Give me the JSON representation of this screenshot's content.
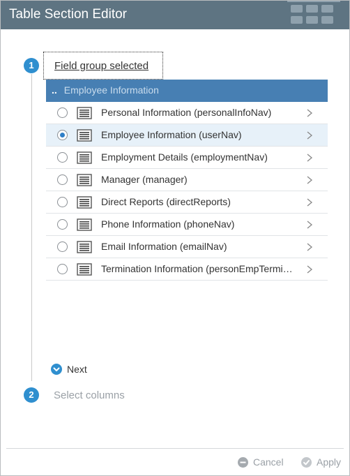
{
  "dialog": {
    "title": "Table Section Editor",
    "header_icon": "table-grid-icon"
  },
  "steps": [
    {
      "number": "1",
      "label": "Field group selected"
    },
    {
      "number": "2",
      "label": "Select columns"
    }
  ],
  "breadcrumb": {
    "up": "..",
    "current": "Employee Information"
  },
  "field_groups": [
    {
      "label": "Personal Information (personalInfoNav)",
      "selected": false
    },
    {
      "label": "Employee Information (userNav)",
      "selected": true
    },
    {
      "label": "Employment Details (employmentNav)",
      "selected": false
    },
    {
      "label": "Manager (manager)",
      "selected": false
    },
    {
      "label": "Direct Reports (directReports)",
      "selected": false
    },
    {
      "label": "Phone Information (phoneNav)",
      "selected": false
    },
    {
      "label": "Email Information (emailNav)",
      "selected": false
    },
    {
      "label": "Termination Information (personEmpTermi…",
      "selected": false
    }
  ],
  "next_label": "Next",
  "footer": {
    "cancel_label": "Cancel",
    "apply_label": "Apply"
  },
  "colors": {
    "header_bg": "#5e7482",
    "accent": "#2f8fcf",
    "breadcrumb_bg": "#477fb3",
    "selected_row": "#e7f1f9"
  }
}
